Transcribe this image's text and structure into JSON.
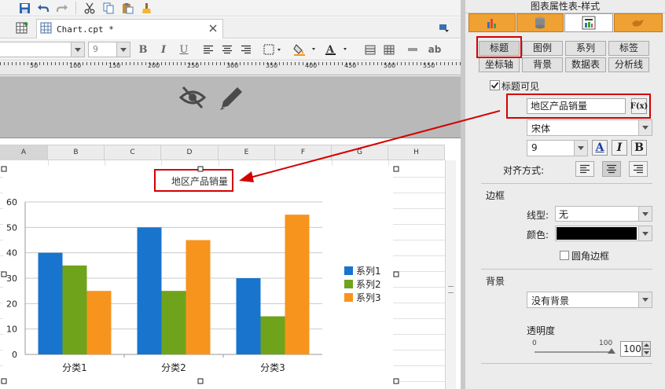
{
  "tab": {
    "doc_label": "Chart.cpt *"
  },
  "format_bar": {
    "font_size": "9",
    "bold": "B",
    "italic": "I",
    "underline": "U",
    "abbr": "ab"
  },
  "ruler": {
    "labels": [
      "50",
      "100",
      "150",
      "200",
      "250",
      "300",
      "350",
      "400",
      "450",
      "500",
      "550"
    ]
  },
  "sheet": {
    "columns": [
      "A",
      "B",
      "C",
      "D",
      "E",
      "F",
      "G",
      "H"
    ]
  },
  "chart_data": {
    "type": "bar",
    "title": "地区产品销量",
    "categories": [
      "分类1",
      "分类2",
      "分类3"
    ],
    "series": [
      {
        "name": "系列1",
        "color": "#1874cd",
        "values": [
          40,
          50,
          30
        ]
      },
      {
        "name": "系列2",
        "color": "#6fa31b",
        "values": [
          35,
          25,
          15
        ]
      },
      {
        "name": "系列3",
        "color": "#f7941d",
        "values": [
          25,
          45,
          55
        ]
      }
    ],
    "yticks": [
      "0",
      "10",
      "20",
      "30",
      "40",
      "50",
      "60"
    ],
    "ylim": [
      0,
      60
    ],
    "grid": true,
    "legend": "right"
  },
  "panel": {
    "title": "图表属性表-样式",
    "subtabs_row1": [
      "标题",
      "图例",
      "系列",
      "标签"
    ],
    "subtabs_row2": [
      "坐标轴",
      "背景",
      "数据表",
      "分析线"
    ],
    "title_visible_label": "标题可见",
    "title_value": "地区产品销量",
    "formula_btn": "F(x)",
    "font_name": "宋体",
    "font_size": "9",
    "font_a": "A",
    "font_i": "I",
    "font_b": "B",
    "align_label": "对齐方式:",
    "border_section": "边框",
    "line_type_label": "线型:",
    "line_type_value": "无",
    "color_label": "颜色:",
    "round_border_label": "圆角边框",
    "bg_section": "背景",
    "bg_value": "没有背景",
    "opacity_label": "透明度",
    "slider_min": "0",
    "slider_max": "100",
    "opacity_value": "100",
    "opacity_level": 1.0
  }
}
